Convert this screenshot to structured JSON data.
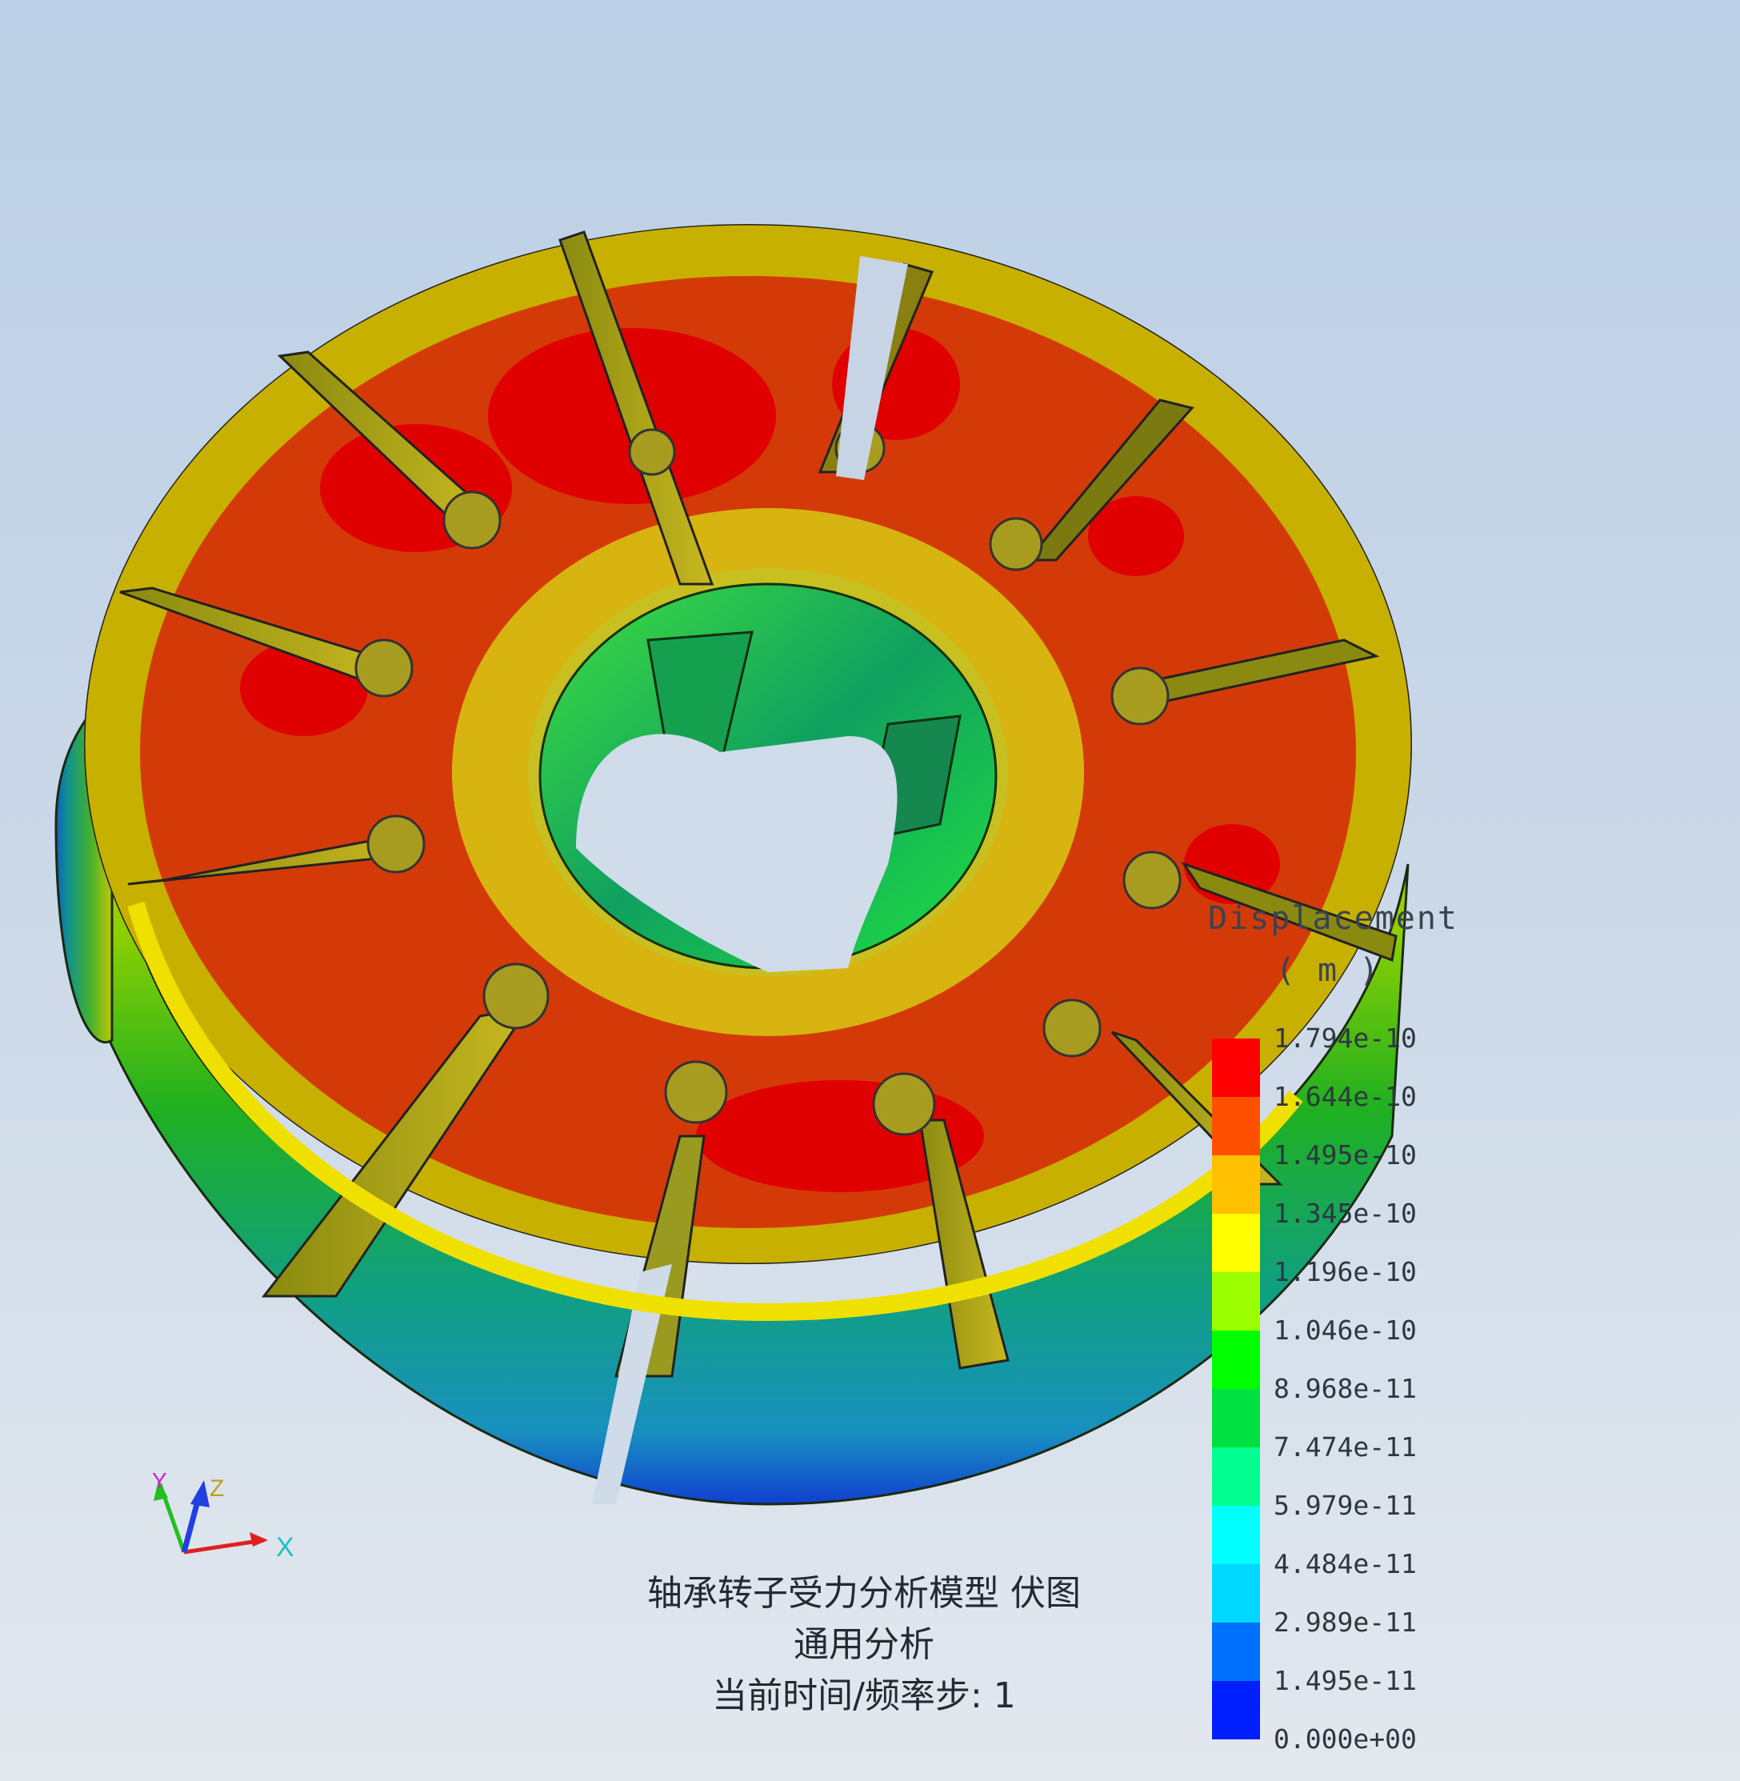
{
  "viewport": {
    "model": "bearing-rotor-mesh",
    "colors": {
      "background_top": "#bccfe6",
      "background_bottom": "#e3e8ee",
      "max": "#ff0000",
      "high": "#d94010",
      "mid_high": "#ffc000",
      "mid": "#ffff00",
      "mid_low": "#00ff00",
      "low": "#00c0ff",
      "min": "#0000ff"
    }
  },
  "legend": {
    "title": "Displacement",
    "unit": "( m )",
    "labels": [
      "1.794e-10",
      "1.644e-10",
      "1.495e-10",
      "1.345e-10",
      "1.196e-10",
      "1.046e-10",
      "8.968e-11",
      "7.474e-11",
      "5.979e-11",
      "4.484e-11",
      "2.989e-11",
      "1.495e-11",
      "0.000e+00"
    ],
    "colors": [
      "#ff0000",
      "#ff5000",
      "#ffc000",
      "#ffff00",
      "#9cff00",
      "#00ff00",
      "#00e040",
      "#00ff90",
      "#00ffff",
      "#00d8ff",
      "#0070ff",
      "#0020ff"
    ]
  },
  "caption": {
    "line1": "轴承转子受力分析模型  伏图",
    "line2": "通用分析",
    "line3": "当前时间/频率步: 1"
  },
  "triad": {
    "x_label": "X",
    "y_label": "Y",
    "z_label": "Z",
    "x_color": "#e02020",
    "y_color": "#20c020",
    "z_color": "#2040e0"
  }
}
